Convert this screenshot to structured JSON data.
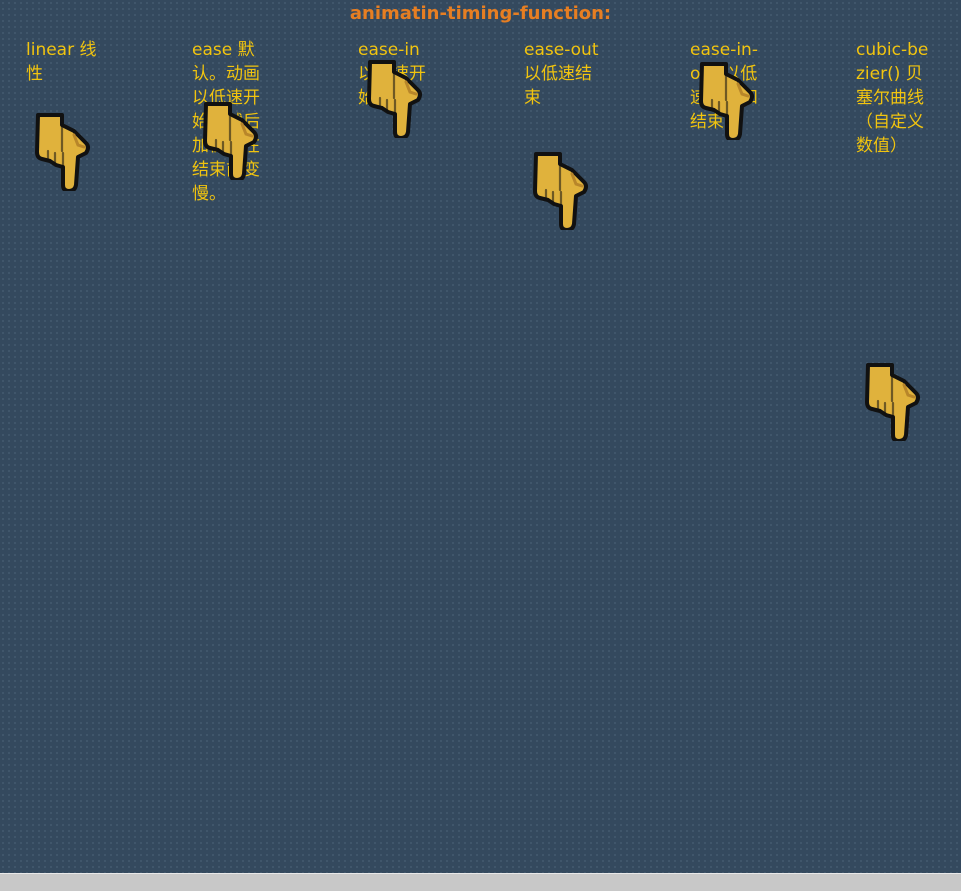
{
  "page": {
    "title": "animatin-timing-function:"
  },
  "columns": [
    {
      "id": "linear",
      "label": "linear 线性"
    },
    {
      "id": "ease",
      "label": "ease 默认。动画以低速开始，然后加快，在结束前变慢。"
    },
    {
      "id": "ease-in",
      "label": "ease-in 以低速开始"
    },
    {
      "id": "ease-out",
      "label": "ease-out 以低速结束"
    },
    {
      "id": "ease-in-out",
      "label": "ease-in-out 以低速开始和结束"
    },
    {
      "id": "cubic",
      "label": "cubic-bezier() 贝塞尔曲线（自定义数值）"
    }
  ],
  "icons": {
    "hand": "pointing-down-hand-icon"
  },
  "colors": {
    "background": "#34495e",
    "title": "#e67e22",
    "label": "#f1c40f",
    "hand_fill": "#e0b23c",
    "hand_outline": "#111111"
  }
}
